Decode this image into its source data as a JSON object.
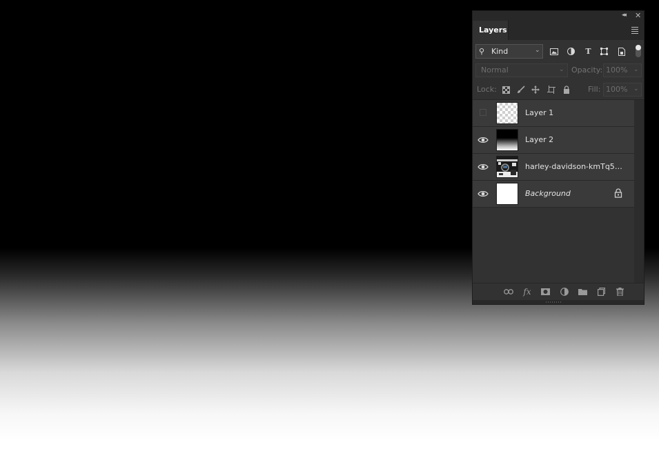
{
  "canvas": {
    "description_colors": {
      "top": "#000000",
      "bottom": "#ffffff"
    }
  },
  "panel": {
    "tab": "Layers",
    "filter": {
      "kind_label": "Kind",
      "icons": [
        "image-filter-icon",
        "adjustment-filter-icon",
        "type-filter-icon",
        "shape-filter-icon",
        "smart-object-filter-icon"
      ]
    },
    "blend_mode": "Normal",
    "opacity_label": "Opacity:",
    "opacity_value": "100%",
    "lock_label": "Lock:",
    "fill_label": "Fill:",
    "fill_value": "100%",
    "layers": [
      {
        "name": "Layer 1",
        "visible": false,
        "thumb": "transparent"
      },
      {
        "name": "Layer 2",
        "visible": true,
        "thumb": "gradient"
      },
      {
        "name": "harley-davidson-kmTq5GU...",
        "visible": true,
        "thumb": "photo"
      },
      {
        "name": "Background",
        "visible": true,
        "thumb": "white",
        "locked": true
      }
    ],
    "footer_icons": [
      "link-layers-icon",
      "fx-icon",
      "add-mask-icon",
      "adjustment-layer-icon",
      "new-group-icon",
      "new-layer-icon",
      "delete-layer-icon"
    ]
  }
}
